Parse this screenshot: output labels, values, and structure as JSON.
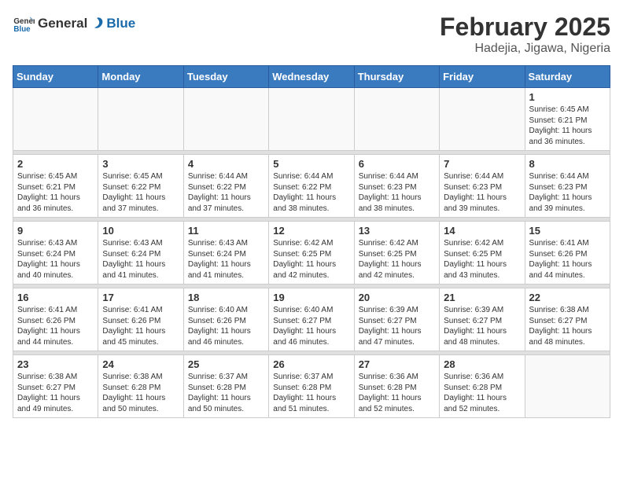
{
  "logo": {
    "text_general": "General",
    "text_blue": "Blue"
  },
  "title": "February 2025",
  "subtitle": "Hadejia, Jigawa, Nigeria",
  "headers": [
    "Sunday",
    "Monday",
    "Tuesday",
    "Wednesday",
    "Thursday",
    "Friday",
    "Saturday"
  ],
  "weeks": [
    [
      {
        "day": "",
        "info": ""
      },
      {
        "day": "",
        "info": ""
      },
      {
        "day": "",
        "info": ""
      },
      {
        "day": "",
        "info": ""
      },
      {
        "day": "",
        "info": ""
      },
      {
        "day": "",
        "info": ""
      },
      {
        "day": "1",
        "info": "Sunrise: 6:45 AM\nSunset: 6:21 PM\nDaylight: 11 hours\nand 36 minutes."
      }
    ],
    [
      {
        "day": "2",
        "info": "Sunrise: 6:45 AM\nSunset: 6:21 PM\nDaylight: 11 hours\nand 36 minutes."
      },
      {
        "day": "3",
        "info": "Sunrise: 6:45 AM\nSunset: 6:22 PM\nDaylight: 11 hours\nand 37 minutes."
      },
      {
        "day": "4",
        "info": "Sunrise: 6:44 AM\nSunset: 6:22 PM\nDaylight: 11 hours\nand 37 minutes."
      },
      {
        "day": "5",
        "info": "Sunrise: 6:44 AM\nSunset: 6:22 PM\nDaylight: 11 hours\nand 38 minutes."
      },
      {
        "day": "6",
        "info": "Sunrise: 6:44 AM\nSunset: 6:23 PM\nDaylight: 11 hours\nand 38 minutes."
      },
      {
        "day": "7",
        "info": "Sunrise: 6:44 AM\nSunset: 6:23 PM\nDaylight: 11 hours\nand 39 minutes."
      },
      {
        "day": "8",
        "info": "Sunrise: 6:44 AM\nSunset: 6:23 PM\nDaylight: 11 hours\nand 39 minutes."
      }
    ],
    [
      {
        "day": "9",
        "info": "Sunrise: 6:43 AM\nSunset: 6:24 PM\nDaylight: 11 hours\nand 40 minutes."
      },
      {
        "day": "10",
        "info": "Sunrise: 6:43 AM\nSunset: 6:24 PM\nDaylight: 11 hours\nand 41 minutes."
      },
      {
        "day": "11",
        "info": "Sunrise: 6:43 AM\nSunset: 6:24 PM\nDaylight: 11 hours\nand 41 minutes."
      },
      {
        "day": "12",
        "info": "Sunrise: 6:42 AM\nSunset: 6:25 PM\nDaylight: 11 hours\nand 42 minutes."
      },
      {
        "day": "13",
        "info": "Sunrise: 6:42 AM\nSunset: 6:25 PM\nDaylight: 11 hours\nand 42 minutes."
      },
      {
        "day": "14",
        "info": "Sunrise: 6:42 AM\nSunset: 6:25 PM\nDaylight: 11 hours\nand 43 minutes."
      },
      {
        "day": "15",
        "info": "Sunrise: 6:41 AM\nSunset: 6:26 PM\nDaylight: 11 hours\nand 44 minutes."
      }
    ],
    [
      {
        "day": "16",
        "info": "Sunrise: 6:41 AM\nSunset: 6:26 PM\nDaylight: 11 hours\nand 44 minutes."
      },
      {
        "day": "17",
        "info": "Sunrise: 6:41 AM\nSunset: 6:26 PM\nDaylight: 11 hours\nand 45 minutes."
      },
      {
        "day": "18",
        "info": "Sunrise: 6:40 AM\nSunset: 6:26 PM\nDaylight: 11 hours\nand 46 minutes."
      },
      {
        "day": "19",
        "info": "Sunrise: 6:40 AM\nSunset: 6:27 PM\nDaylight: 11 hours\nand 46 minutes."
      },
      {
        "day": "20",
        "info": "Sunrise: 6:39 AM\nSunset: 6:27 PM\nDaylight: 11 hours\nand 47 minutes."
      },
      {
        "day": "21",
        "info": "Sunrise: 6:39 AM\nSunset: 6:27 PM\nDaylight: 11 hours\nand 48 minutes."
      },
      {
        "day": "22",
        "info": "Sunrise: 6:38 AM\nSunset: 6:27 PM\nDaylight: 11 hours\nand 48 minutes."
      }
    ],
    [
      {
        "day": "23",
        "info": "Sunrise: 6:38 AM\nSunset: 6:27 PM\nDaylight: 11 hours\nand 49 minutes."
      },
      {
        "day": "24",
        "info": "Sunrise: 6:38 AM\nSunset: 6:28 PM\nDaylight: 11 hours\nand 50 minutes."
      },
      {
        "day": "25",
        "info": "Sunrise: 6:37 AM\nSunset: 6:28 PM\nDaylight: 11 hours\nand 50 minutes."
      },
      {
        "day": "26",
        "info": "Sunrise: 6:37 AM\nSunset: 6:28 PM\nDaylight: 11 hours\nand 51 minutes."
      },
      {
        "day": "27",
        "info": "Sunrise: 6:36 AM\nSunset: 6:28 PM\nDaylight: 11 hours\nand 52 minutes."
      },
      {
        "day": "28",
        "info": "Sunrise: 6:36 AM\nSunset: 6:28 PM\nDaylight: 11 hours\nand 52 minutes."
      },
      {
        "day": "",
        "info": ""
      }
    ]
  ]
}
